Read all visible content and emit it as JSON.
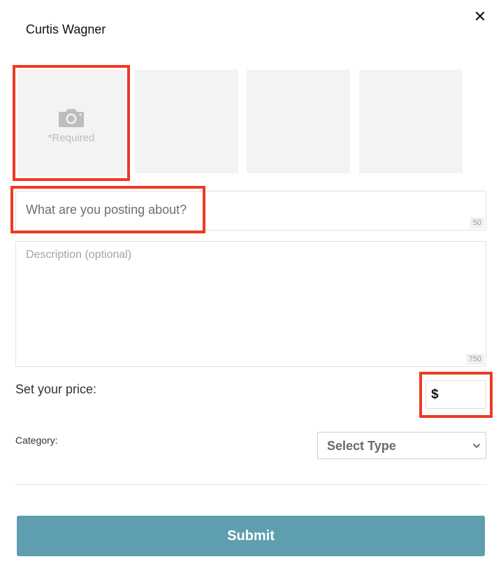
{
  "header": {
    "user_name": "Curtis Wagner",
    "close_icon": "close-icon"
  },
  "photos": {
    "main_icon": "camera-icon",
    "required_label": "*Required",
    "slot_count": 4
  },
  "title_field": {
    "placeholder": "What are you posting about?",
    "value": "",
    "char_limit": "50"
  },
  "description_field": {
    "placeholder": "Description (optional)",
    "value": "",
    "char_limit": "750"
  },
  "price": {
    "label": "Set your price:",
    "currency_symbol": "$",
    "value": ""
  },
  "category": {
    "label": "Category:",
    "selected": "Select Type"
  },
  "submit": {
    "label": "Submit"
  },
  "colors": {
    "accent": "#5e9eae",
    "highlight": "#f03a22",
    "slot_bg": "#f3f3f3"
  }
}
